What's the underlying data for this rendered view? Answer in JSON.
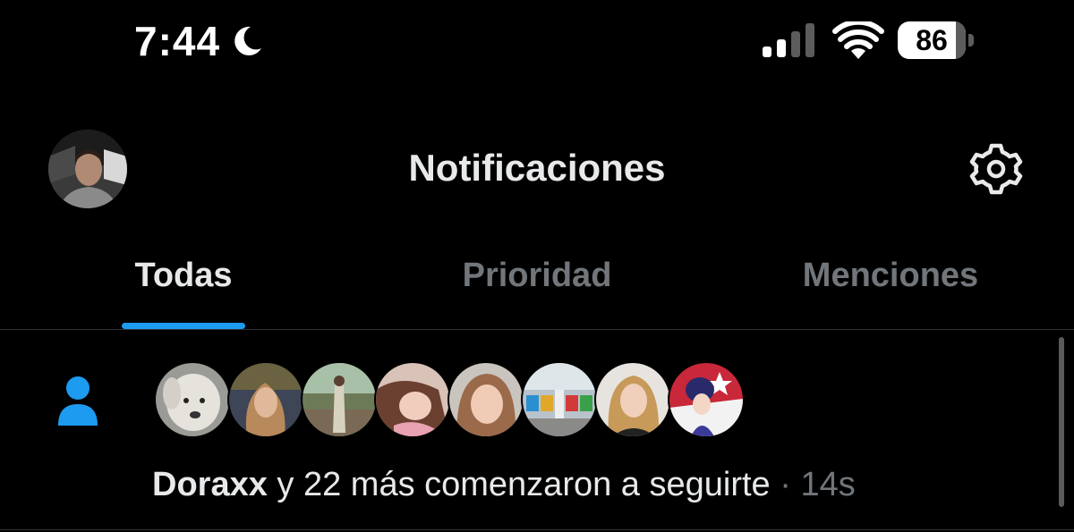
{
  "status_bar": {
    "time": "7:44",
    "moon_icon": "moon-icon",
    "signal_icon": "cellular-signal-icon",
    "signal_bars_active": 2,
    "signal_bars_total": 4,
    "wifi_icon": "wifi-icon",
    "battery_level": "86",
    "battery_fraction": 0.86
  },
  "header": {
    "title": "Notificaciones",
    "avatar_icon": "profile-avatar",
    "settings_icon": "gear-icon"
  },
  "tabs": [
    {
      "label": "Todas",
      "active": true
    },
    {
      "label": "Prioridad",
      "active": false
    },
    {
      "label": "Menciones",
      "active": false
    }
  ],
  "notification": {
    "type_icon": "person-icon",
    "name": "Doraxx",
    "text": " y 22 más comenzaron a seguirte",
    "separator": " · ",
    "time": "14s",
    "follower_avatar_count": 8
  },
  "colors": {
    "background": "#000000",
    "accent": "#1d9bf0",
    "primary_text": "#e7e9ea",
    "secondary_text": "#71767b",
    "divider": "#2f3336"
  }
}
